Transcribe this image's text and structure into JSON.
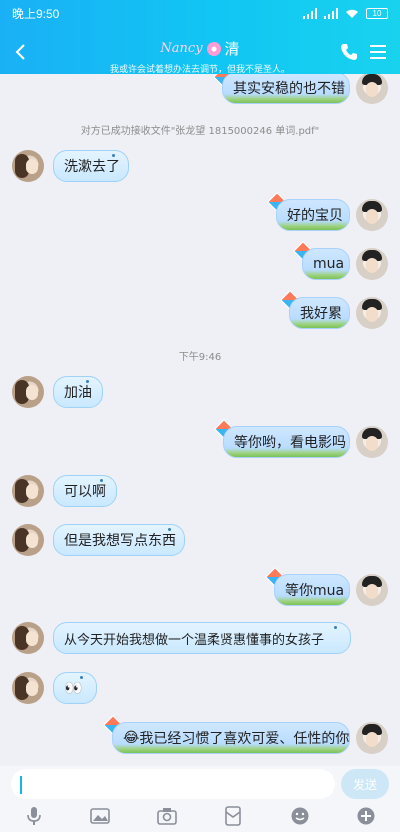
{
  "status_bar": {
    "time": "晚上9:50",
    "battery": "10"
  },
  "header": {
    "title_decoration": "Nancy",
    "name": "清",
    "signature": "我或许会试着想办法去调节，但我不是圣人。"
  },
  "messages": [
    {
      "sender": "me",
      "text": "其实安稳的也不错"
    },
    {
      "type": "system",
      "text": "对方已成功接收文件\"张龙望 1815000246 单词.pdf\""
    },
    {
      "sender": "her",
      "text": "洗漱去了"
    },
    {
      "sender": "me",
      "text": "好的宝贝"
    },
    {
      "sender": "me",
      "text": "mua"
    },
    {
      "sender": "me",
      "text": "我好累"
    },
    {
      "type": "time",
      "text": "下午9:46"
    },
    {
      "sender": "her",
      "text": "加油"
    },
    {
      "sender": "me",
      "text": "等你哟，看电影吗"
    },
    {
      "sender": "her",
      "text": "可以啊"
    },
    {
      "sender": "her",
      "text": "但是我想写点东西"
    },
    {
      "sender": "me",
      "text": "等你mua"
    },
    {
      "sender": "her",
      "text": "从今天开始我想做一个温柔贤惠懂事的女孩子"
    },
    {
      "sender": "her",
      "text": "👀"
    },
    {
      "sender": "me",
      "text": "我已经习惯了喜欢可爱、任性的你",
      "emoji": "😂"
    }
  ],
  "input": {
    "placeholder": "",
    "send_label": "发送"
  },
  "toolbar": [
    "mic-icon",
    "image-icon",
    "camera-icon",
    "red-packet-icon",
    "emoji-icon",
    "plus-icon"
  ],
  "colors": {
    "header_start": "#1ab0f5",
    "header_end": "#19d2ee",
    "accent": "#16b4f4"
  }
}
